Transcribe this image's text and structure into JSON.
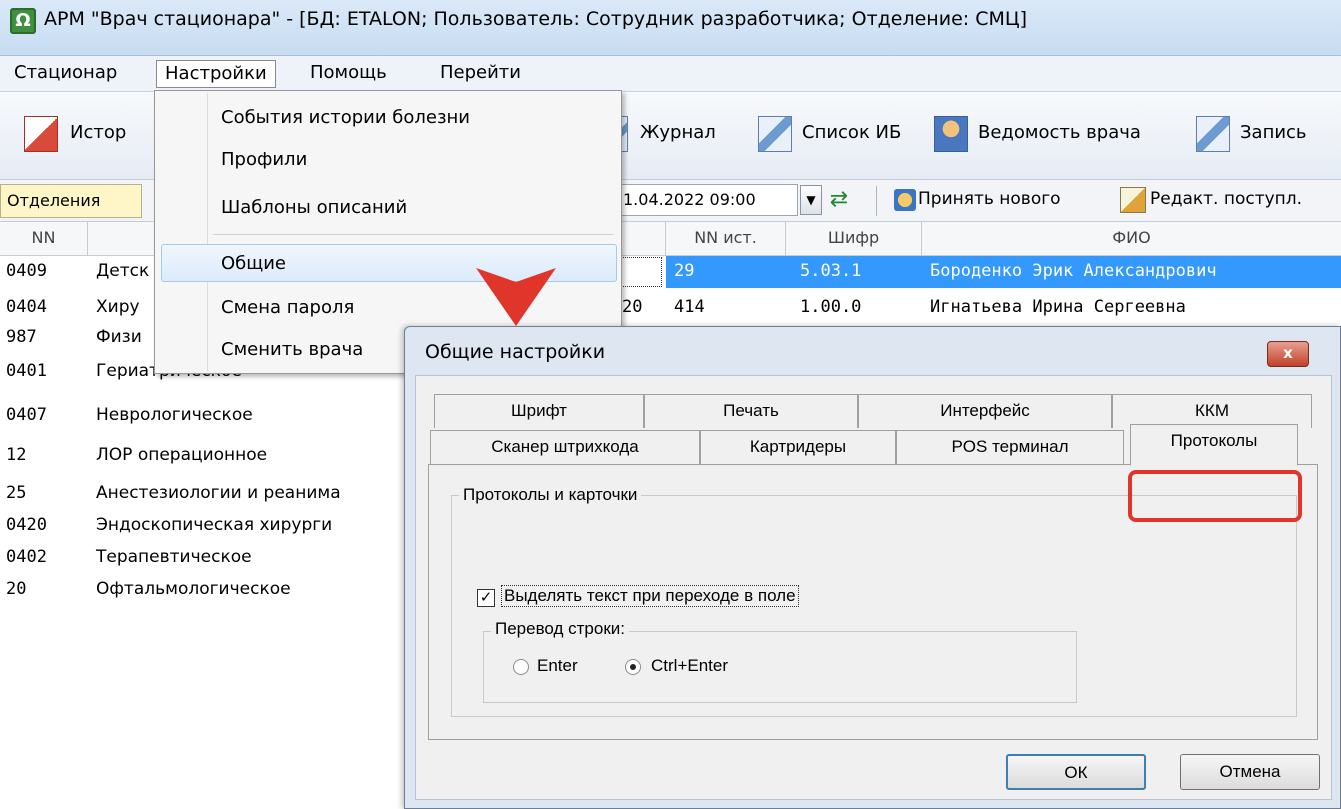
{
  "window": {
    "title": "АРМ \"Врач стационара\"  -  [БД: ETALON;  Пользователь: Сотрудник разработчика; Отделение: СМЦ]",
    "icon_glyph": "Ω"
  },
  "menubar": [
    "Стационар",
    "Настройки",
    "Помощь",
    "Перейти"
  ],
  "toolbar": {
    "history_label": "Истор",
    "journal_label": "Журнал",
    "list_label": "Список ИБ",
    "statement_label": "Ведомость врача",
    "record_label": "Запись"
  },
  "row2": {
    "departments_tab": "Отделения",
    "date_value": "1.04.2022 09:00",
    "accept_label": "Принять нового",
    "edit_label": "Редакт. поступл."
  },
  "grid": {
    "headers": {
      "nn": "NN",
      "nn_src": "NN ист.",
      "code": "Шифр",
      "fio": "ФИО"
    },
    "departments": [
      {
        "nn": "0409",
        "name": "Детск"
      },
      {
        "nn": "0404",
        "name": "Хиру"
      },
      {
        "nn": "987",
        "name": "Физи"
      },
      {
        "nn": "0401",
        "name": "Гериатрическое"
      },
      {
        "nn": "0407",
        "name": "Неврологическое"
      },
      {
        "nn": "12",
        "name": "ЛОР операционное"
      },
      {
        "nn": "25",
        "name": "Анестезиологии и реанима"
      },
      {
        "nn": "0420",
        "name": "Эндоскопическая хирурги"
      },
      {
        "nn": "0402",
        "name": "Терапевтическое"
      },
      {
        "nn": "20",
        "name": "Офтальмологическое"
      }
    ],
    "patients": [
      {
        "prefix": "",
        "nn": "29",
        "code": "5.03.1",
        "fio": "Бороденко Эрик Александрович",
        "selected": true
      },
      {
        "prefix": "20",
        "nn": "414",
        "code": "1.00.0",
        "fio": "Игнатьева Ирина Сергеевна",
        "selected": false
      }
    ]
  },
  "dropdown": {
    "items": [
      "События истории болезни",
      "Профили",
      "Шаблоны описаний",
      "Общие",
      "Смена пароля",
      "Сменить врача"
    ],
    "hovered": "Общие"
  },
  "dialog": {
    "title": "Общие настройки",
    "close_glyph": "x",
    "tabs_row1": [
      "Шрифт",
      "Печать",
      "Интерфейс",
      "ККМ"
    ],
    "tabs_row2": [
      "Сканер штрихкода",
      "Картридеры",
      "POS терминал",
      "Протоколы"
    ],
    "active_tab": "Протоколы",
    "group_title": "Протоколы и карточки",
    "checkbox_label": "Выделять текст при переходе в поле",
    "checkbox_checked": true,
    "line_group_title": "Перевод строки:",
    "radio_options": [
      "Enter",
      "Ctrl+Enter"
    ],
    "radio_selected": "Ctrl+Enter",
    "ok": "ОК",
    "cancel": "Отмена"
  },
  "colors": {
    "selection": "#3399ff",
    "highlight": "#e0352b",
    "arrow": "#e0352b"
  }
}
